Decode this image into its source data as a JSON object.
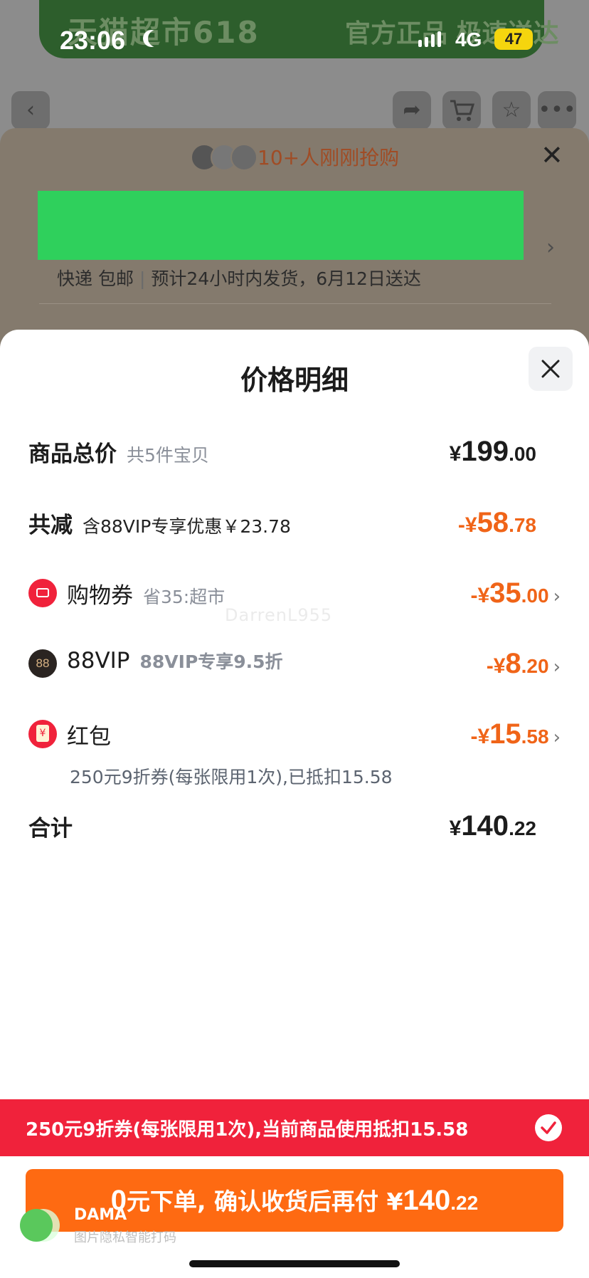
{
  "status_bar": {
    "time": "23:06",
    "network": "4G",
    "battery": "47"
  },
  "background": {
    "banner_brand": "天猫超市618",
    "banner_slogan": "官方正品 极速送达",
    "buyers_text": "10+人刚刚抢购",
    "delivery_method": "快递 包邮",
    "delivery_estimate": "预计24小时内发货，6月12日送达"
  },
  "sheet": {
    "title": "价格明细",
    "rows": {
      "total": {
        "label": "商品总价",
        "sub": "共5件宝贝",
        "sym": "¥",
        "int": "199",
        "dec": ".00"
      },
      "reduce": {
        "label": "共减",
        "sub": "含88VIP专享优惠￥23.78",
        "sym": "-¥",
        "int": "58",
        "dec": ".78"
      },
      "coupon": {
        "label": "购物券",
        "sub": "省35:超市",
        "sym": "-¥",
        "int": "35",
        "dec": ".00"
      },
      "vip": {
        "label": "88VIP",
        "sub": "88VIP专享9.5折",
        "icon_text": "88",
        "sym": "-¥",
        "int": "8",
        "dec": ".20"
      },
      "redpacket": {
        "label": "红包",
        "sym": "-¥",
        "int": "15",
        "dec": ".58",
        "note": "250元9折券(每张限用1次),已抵扣15.58"
      },
      "sum": {
        "label": "合计",
        "sym": "¥",
        "int": "140",
        "dec": ".22"
      }
    },
    "watermark": "DarrenL955"
  },
  "promo_bar": {
    "text": "250元9折券(每张限用1次),当前商品使用抵扣15.58"
  },
  "submit": {
    "zero": "0",
    "text": "元下单, 确认收货后再付 ",
    "sym": "¥",
    "int": "140",
    "dec": ".22"
  },
  "overlay_watermark": {
    "brand": "DAMA",
    "sub": "图片隐私智能打码"
  },
  "colors": {
    "accent_orange": "#f06418",
    "button_orange": "#fe6a12",
    "promo_red": "#f0223b",
    "redacted_green": "#2fd05c"
  },
  "icons": [
    "back-icon",
    "share-icon",
    "cart-icon",
    "star-icon",
    "more-icon",
    "close-icon",
    "coupon-icon",
    "vip-88-icon",
    "red-packet-icon",
    "chevron-right-icon",
    "check-icon"
  ]
}
